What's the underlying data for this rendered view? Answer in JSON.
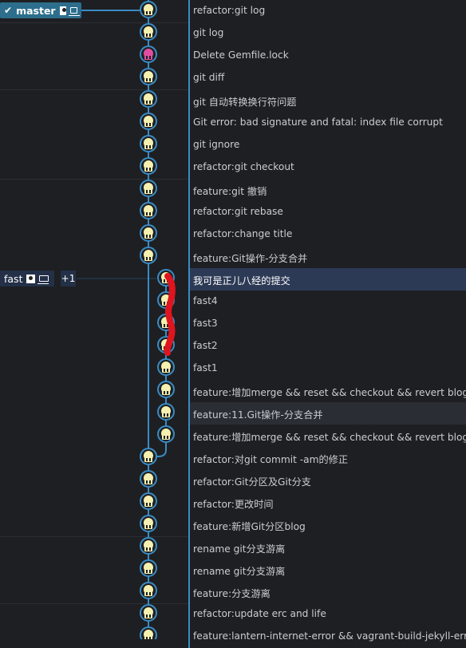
{
  "branches": {
    "master": {
      "label": "master",
      "check_icon": "check-icon",
      "avatar_icon": "avatar-icon",
      "computer_icon": "laptop-icon"
    },
    "fast": {
      "label": "fast",
      "avatar_icon": "avatar-icon",
      "computer_icon": "laptop-icon",
      "more_label": "+1"
    }
  },
  "colors": {
    "background": "#1e1f22",
    "lane": "#3a8bc4",
    "selected_row": "#2d3a56",
    "avatar_fill": "#f6f0b0",
    "avatar_fill_alt": "#e04ea0",
    "annotation": "#e0141e"
  },
  "commits": [
    {
      "message": "refactor:git log",
      "lane": 0
    },
    {
      "message": "git log",
      "lane": 0
    },
    {
      "message": "Delete Gemfile.lock",
      "lane": 0,
      "avatar": "alt"
    },
    {
      "message": "git diff",
      "lane": 0
    },
    {
      "message": "git 自动转换换行符问题",
      "lane": 0
    },
    {
      "message": "Git error: bad signature and fatal: index file corrupt",
      "lane": 0
    },
    {
      "message": "git ignore",
      "lane": 0
    },
    {
      "message": "refactor:git checkout",
      "lane": 0
    },
    {
      "message": "feature:git 撤销",
      "lane": 0
    },
    {
      "message": "refactor:git rebase",
      "lane": 0
    },
    {
      "message": "refactor:change title",
      "lane": 0
    },
    {
      "message": "feature:Git操作-分支合并",
      "lane": 0
    },
    {
      "message": "我可是正儿八经的提交",
      "lane": 1,
      "selected": true
    },
    {
      "message": "fast4",
      "lane": 1
    },
    {
      "message": "fast3",
      "lane": 1
    },
    {
      "message": "fast2",
      "lane": 1
    },
    {
      "message": "fast1",
      "lane": 1
    },
    {
      "message": "feature:增加merge && reset && checkout && revert blog",
      "lane": 1
    },
    {
      "message": "feature:11.Git操作-分支合并",
      "lane": 1,
      "hover": true
    },
    {
      "message": "feature:增加merge && reset && checkout && revert blog",
      "lane": 1
    },
    {
      "message": "refactor:对git commit -am的修正",
      "lane": 0
    },
    {
      "message": "refactor:Git分区及Git分支",
      "lane": 0
    },
    {
      "message": "refactor:更改时间",
      "lane": 0
    },
    {
      "message": "feature:新增Git分区blog",
      "lane": 0
    },
    {
      "message": "rename git分支游离",
      "lane": 0
    },
    {
      "message": "rename git分支游离",
      "lane": 0
    },
    {
      "message": "feature:分支游离",
      "lane": 0
    },
    {
      "message": "refactor:update erc and life",
      "lane": 0
    },
    {
      "message": "feature:lantern-internet-error && vagrant-build-jekyll-error",
      "lane": 0
    }
  ]
}
